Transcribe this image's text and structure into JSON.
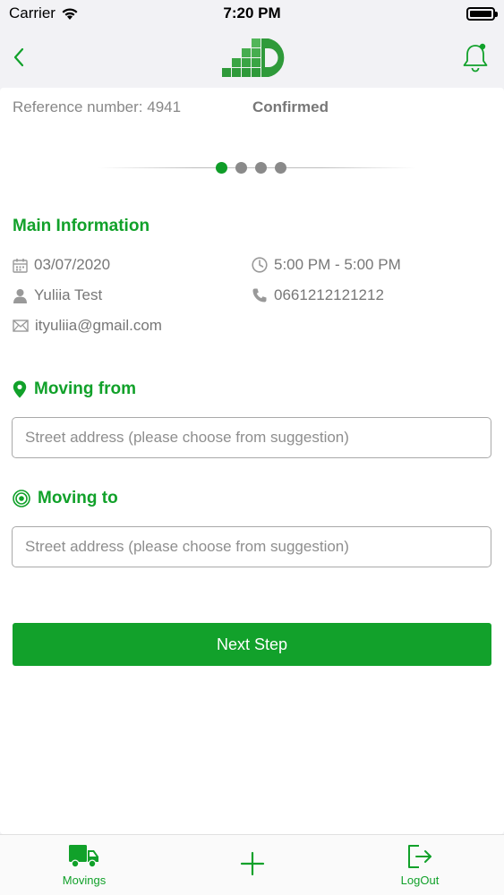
{
  "status_bar": {
    "carrier": "Carrier",
    "time": "7:20 PM"
  },
  "nav": {
    "back_icon": "chevron-left-icon",
    "logo_icon": "company-logo",
    "bell_icon": "bell-notification-icon"
  },
  "order": {
    "reference": "Reference number: 4941",
    "status": "Confirmed"
  },
  "stepper": {
    "total_steps": 4,
    "current_step": 1
  },
  "main_info": {
    "title": "Main Information",
    "date": "03/07/2020",
    "time": "5:00 PM - 5:00 PM",
    "name": "Yuliia Test",
    "phone": "0661212121212",
    "email": "ityuliia@gmail.com"
  },
  "moving_from": {
    "title": "Moving from",
    "placeholder": "Street address (please choose from suggestion)",
    "value": ""
  },
  "moving_to": {
    "title": "Moving to",
    "placeholder": "Street address (please choose from suggestion)",
    "value": ""
  },
  "next_button": "Next Step",
  "tabs": [
    {
      "label": "Movings",
      "icon": "truck-icon"
    },
    {
      "label": "",
      "icon": "plus-icon"
    },
    {
      "label": "LogOut",
      "icon": "logout-icon"
    }
  ],
  "colors": {
    "accent": "#11a12a",
    "text": "#777777",
    "border": "#a9a9a9"
  }
}
